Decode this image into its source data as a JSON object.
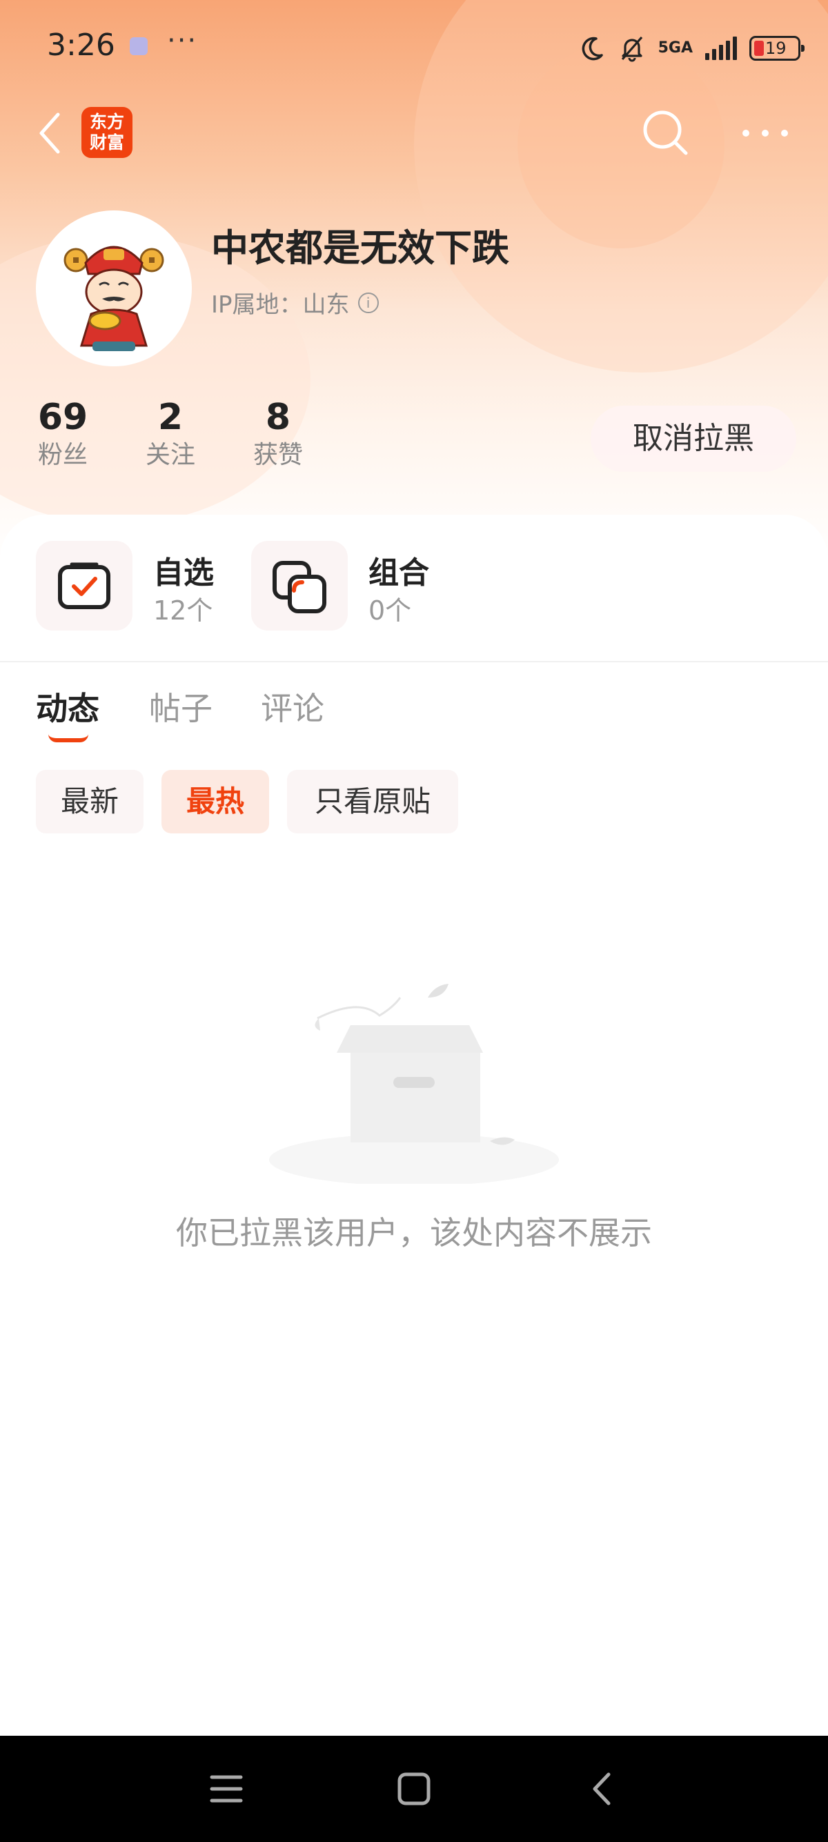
{
  "status_bar": {
    "time": "3:26",
    "dots": "···",
    "network": "5GA",
    "battery": "19"
  },
  "header": {
    "logo_text": "东方财富"
  },
  "profile": {
    "username": "中农都是无效下跌",
    "ip_location": "IP属地：山东",
    "stats": [
      {
        "value": "69",
        "label": "粉丝"
      },
      {
        "value": "2",
        "label": "关注"
      },
      {
        "value": "8",
        "label": "获赞"
      }
    ],
    "unblock_label": "取消拉黑"
  },
  "portfolio": [
    {
      "title": "自选",
      "count": "12个",
      "icon": "checklist-icon"
    },
    {
      "title": "组合",
      "count": "0个",
      "icon": "combination-icon"
    }
  ],
  "tabs": [
    {
      "label": "动态",
      "active": true
    },
    {
      "label": "帖子",
      "active": false
    },
    {
      "label": "评论",
      "active": false
    }
  ],
  "filters": [
    {
      "label": "最新",
      "active": false
    },
    {
      "label": "最热",
      "active": true
    },
    {
      "label": "只看原贴",
      "active": false
    }
  ],
  "empty_state": {
    "message": "你已拉黑该用户，该处内容不展示"
  },
  "colors": {
    "accent": "#f0420f",
    "hero_top": "#f8a575"
  }
}
